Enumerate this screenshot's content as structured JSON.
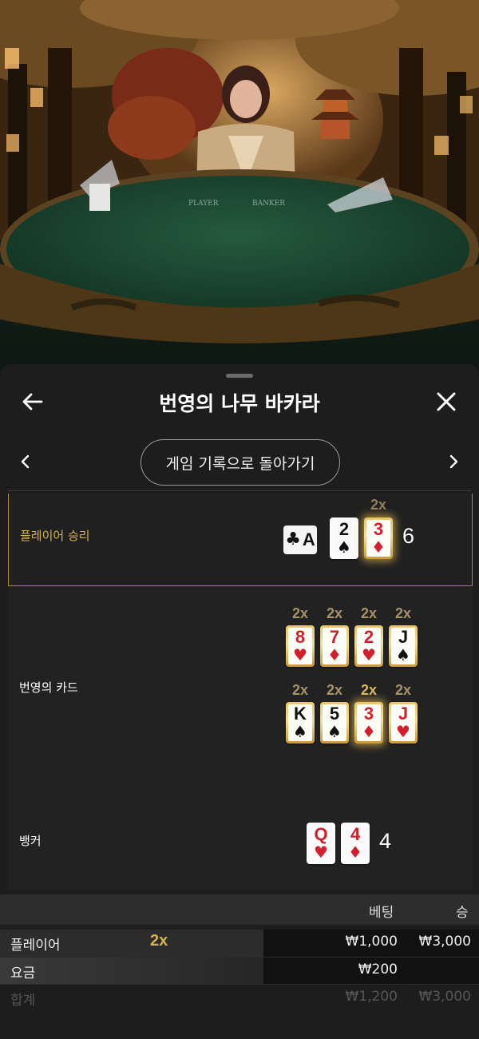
{
  "scene": {
    "table_markings": [
      "PLAYER",
      "BANKER"
    ]
  },
  "header": {
    "title": "번영의 나무 바카라",
    "back_icon": "arrow-left-icon",
    "close_icon": "close-icon"
  },
  "navigation": {
    "history_label": "게임 기록으로 돌아가기",
    "prev_icon": "chevron-left-icon",
    "next_icon": "chevron-right-icon"
  },
  "rows": {
    "player": {
      "label": "플레이어 승리",
      "cards": [
        {
          "rank": "A",
          "suit": "♣",
          "color": "black",
          "orientation": "horizontal"
        },
        {
          "rank": "2",
          "suit": "♠",
          "color": "black"
        },
        {
          "rank": "3",
          "suit": "♦",
          "color": "red",
          "multiplier": "2x",
          "gold": true
        }
      ],
      "total": "6"
    },
    "fortune": {
      "label": "번영의 카드",
      "top": [
        {
          "rank": "8",
          "suit": "♥",
          "color": "red",
          "multiplier": "2x"
        },
        {
          "rank": "7",
          "suit": "♦",
          "color": "red",
          "multiplier": "2x"
        },
        {
          "rank": "2",
          "suit": "♥",
          "color": "red",
          "multiplier": "2x"
        },
        {
          "rank": "J",
          "suit": "♠",
          "color": "black",
          "multiplier": "2x"
        }
      ],
      "bottom": [
        {
          "rank": "K",
          "suit": "♠",
          "color": "black",
          "multiplier": "2x"
        },
        {
          "rank": "5",
          "suit": "♠",
          "color": "black",
          "multiplier": "2x"
        },
        {
          "rank": "3",
          "suit": "♦",
          "color": "red",
          "multiplier": "2x",
          "highlighted": true
        },
        {
          "rank": "J",
          "suit": "♥",
          "color": "red",
          "multiplier": "2x"
        }
      ]
    },
    "banker": {
      "label": "뱅커",
      "cards": [
        {
          "rank": "Q",
          "suit": "♥",
          "color": "red"
        },
        {
          "rank": "4",
          "suit": "♦",
          "color": "red"
        }
      ],
      "total": "4"
    }
  },
  "summary": {
    "headers": {
      "bet": "베팅",
      "win": "승"
    },
    "rows": [
      {
        "label": "플레이어",
        "multiplier": "2x",
        "bet": "₩1,000",
        "win": "₩3,000"
      },
      {
        "label": "요금",
        "bet": "₩200",
        "win": ""
      },
      {
        "label": "합계",
        "bet": "₩1,200",
        "win": "₩3,000"
      }
    ]
  },
  "colors": {
    "gold": "#d6b14a",
    "felt": "#1f4a34",
    "red_suit": "#d21f2b"
  }
}
